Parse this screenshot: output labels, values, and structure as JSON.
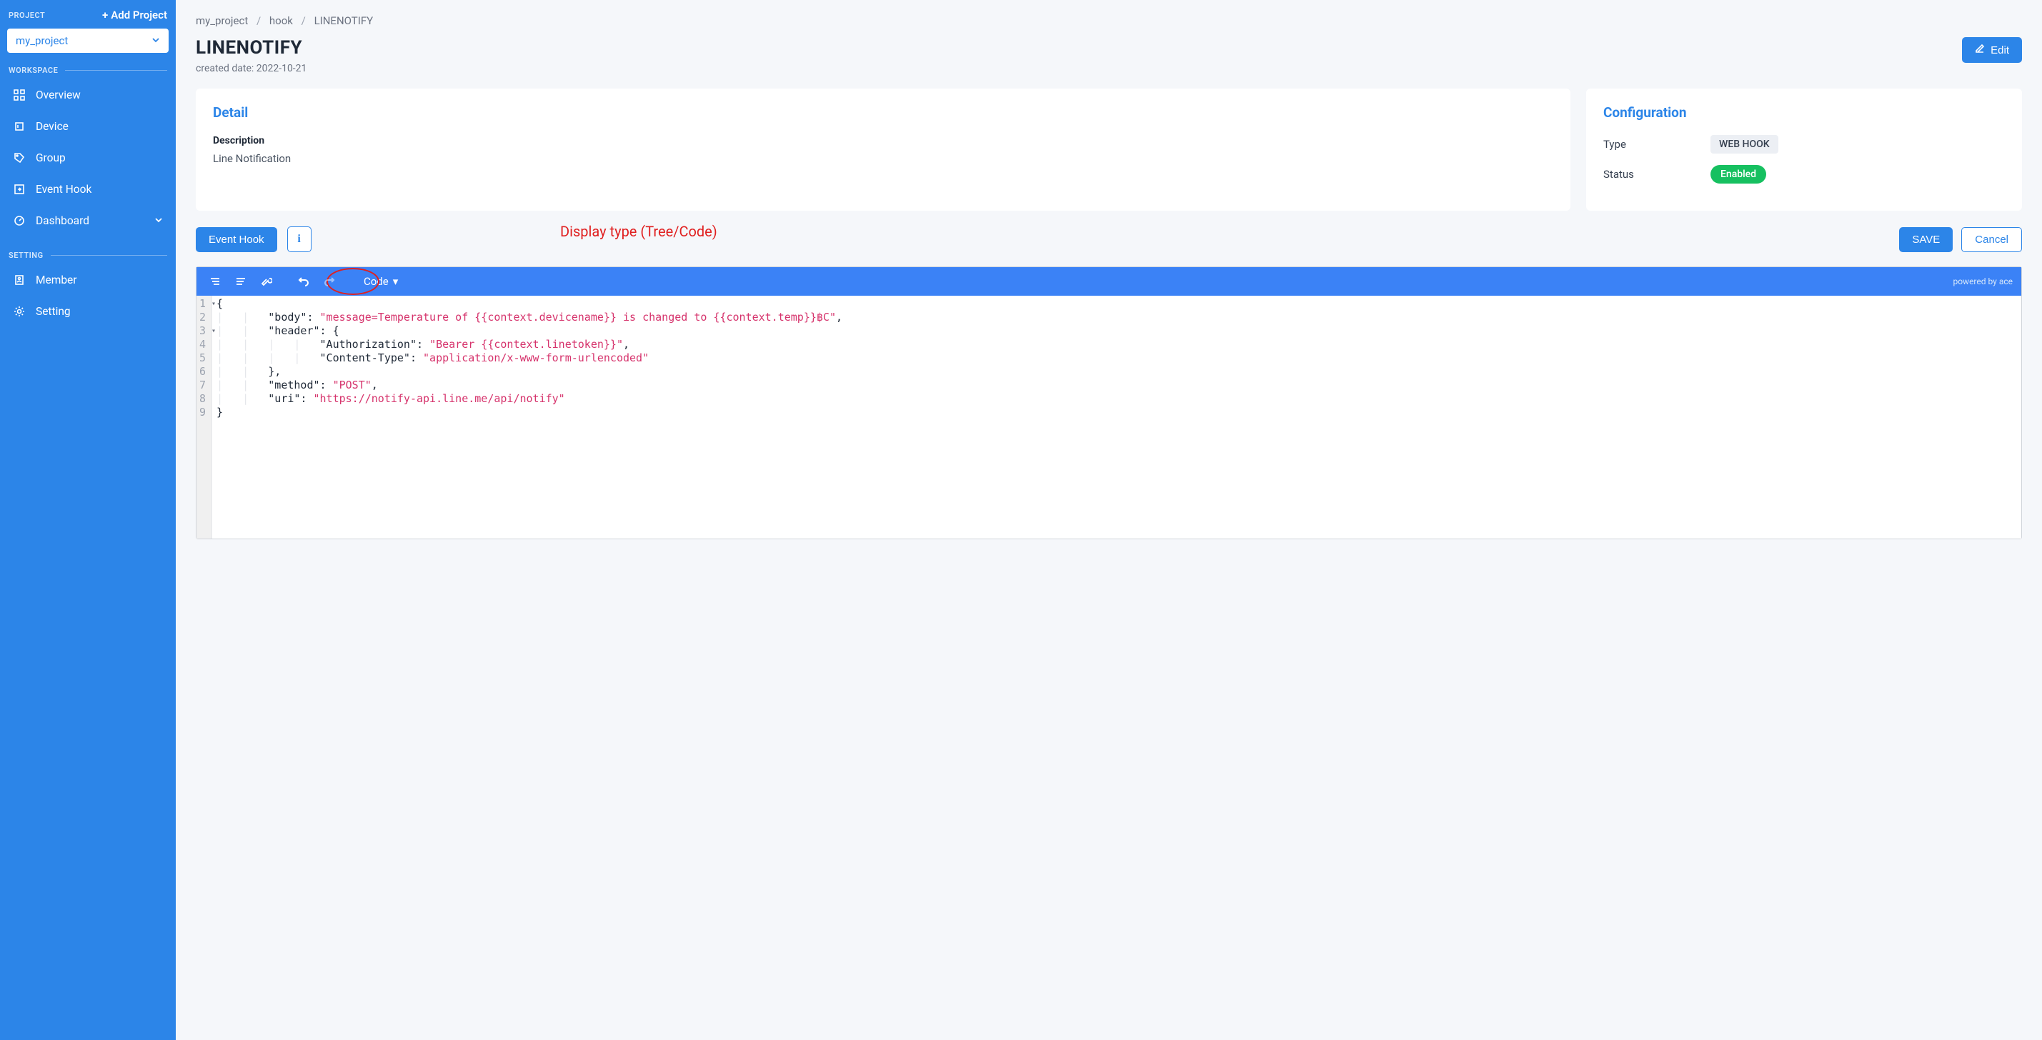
{
  "sidebar": {
    "project_section_label": "PROJECT",
    "add_project_label": "Add Project",
    "selected_project": "my_project",
    "workspace_label": "WORKSPACE",
    "setting_label": "SETTING",
    "nav_workspace": [
      {
        "label": "Overview"
      },
      {
        "label": "Device"
      },
      {
        "label": "Group"
      },
      {
        "label": "Event Hook"
      },
      {
        "label": "Dashboard",
        "has_submenu": true
      }
    ],
    "nav_setting": [
      {
        "label": "Member"
      },
      {
        "label": "Setting"
      }
    ]
  },
  "breadcrumb": {
    "items": [
      "my_project",
      "hook",
      "LINENOTIFY"
    ]
  },
  "header": {
    "title": "LINENOTIFY",
    "created_label": "created date: 2022-10-21",
    "edit_label": "Edit"
  },
  "detail": {
    "title": "Detail",
    "description_label": "Description",
    "description_value": "Line Notification"
  },
  "config": {
    "title": "Configuration",
    "type_label": "Type",
    "type_value": "WEB HOOK",
    "status_label": "Status",
    "status_value": "Enabled"
  },
  "toolbar": {
    "event_hook_label": "Event Hook",
    "info_label": "i",
    "save_label": "SAVE",
    "cancel_label": "Cancel"
  },
  "annotation": {
    "text": "Display type (Tree/Code)"
  },
  "editor": {
    "mode_label": "Code",
    "powered_label": "powered by ace",
    "line_count": 9,
    "json_content": {
      "body": "message=Temperature of {{context.devicename}} is changed to {{context.temp}}฿C",
      "header": {
        "Authorization": "Bearer {{context.linetoken}}",
        "Content-Type": "application/x-www-form-urlencoded"
      },
      "method": "POST",
      "uri": "https://notify-api.line.me/api/notify"
    },
    "lines": [
      {
        "n": 1,
        "fold": true,
        "indent": 0,
        "tokens": [
          {
            "t": "punc",
            "v": "{"
          }
        ]
      },
      {
        "n": 2,
        "indent": 2,
        "tokens": [
          {
            "t": "key",
            "v": "\"body\""
          },
          {
            "t": "punc",
            "v": ": "
          },
          {
            "t": "str",
            "v": "\"message=Temperature of {{context.devicename}} is changed to {{context.temp}}฿C\""
          },
          {
            "t": "punc",
            "v": ","
          }
        ]
      },
      {
        "n": 3,
        "fold": true,
        "indent": 2,
        "tokens": [
          {
            "t": "key",
            "v": "\"header\""
          },
          {
            "t": "punc",
            "v": ": {"
          }
        ]
      },
      {
        "n": 4,
        "indent": 4,
        "tokens": [
          {
            "t": "key",
            "v": "\"Authorization\""
          },
          {
            "t": "punc",
            "v": ": "
          },
          {
            "t": "str",
            "v": "\"Bearer {{context.linetoken}}\""
          },
          {
            "t": "punc",
            "v": ","
          }
        ]
      },
      {
        "n": 5,
        "indent": 4,
        "tokens": [
          {
            "t": "key",
            "v": "\"Content-Type\""
          },
          {
            "t": "punc",
            "v": ": "
          },
          {
            "t": "str",
            "v": "\"application/x-www-form-urlencoded\""
          }
        ]
      },
      {
        "n": 6,
        "indent": 2,
        "tokens": [
          {
            "t": "punc",
            "v": "},"
          }
        ]
      },
      {
        "n": 7,
        "indent": 2,
        "tokens": [
          {
            "t": "key",
            "v": "\"method\""
          },
          {
            "t": "punc",
            "v": ": "
          },
          {
            "t": "str",
            "v": "\"POST\""
          },
          {
            "t": "punc",
            "v": ","
          }
        ]
      },
      {
        "n": 8,
        "indent": 2,
        "tokens": [
          {
            "t": "key",
            "v": "\"uri\""
          },
          {
            "t": "punc",
            "v": ": "
          },
          {
            "t": "str",
            "v": "\"https://notify-api.line.me/api/notify\""
          }
        ]
      },
      {
        "n": 9,
        "indent": 0,
        "tokens": [
          {
            "t": "punc",
            "v": "}"
          }
        ]
      }
    ]
  }
}
